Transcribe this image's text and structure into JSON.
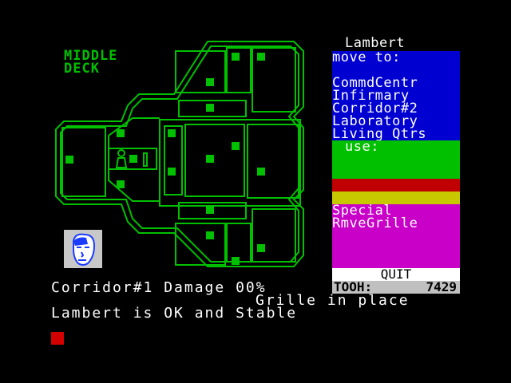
{
  "deck": {
    "line1": "MIDDLE",
    "line2": "DECK"
  },
  "menu": {
    "character": "Lambert",
    "move_heading": "move to:",
    "destinations": [
      "CommdCentr",
      "Infirmary",
      "Corridor#2",
      "Laboratory",
      "Living Qtrs"
    ],
    "use_heading": "use:",
    "special_heading": "Special",
    "special_action": "RmveGrille",
    "quit_label": "QUIT",
    "timer_label": "TOOH:",
    "timer_value": "7429"
  },
  "status": {
    "line1": "Corridor#1 Damage 00%",
    "line2": "Grille in place",
    "line3": "Lambert is OK and Stable"
  },
  "colors": {
    "map_green": "#00c000",
    "move_bg": "#0000d0",
    "use_bg": "#00c000",
    "bar_red": "#c00000",
    "bar_yellow": "#c8c800",
    "special_bg": "#c800c8",
    "cursor_red": "#d40000"
  }
}
